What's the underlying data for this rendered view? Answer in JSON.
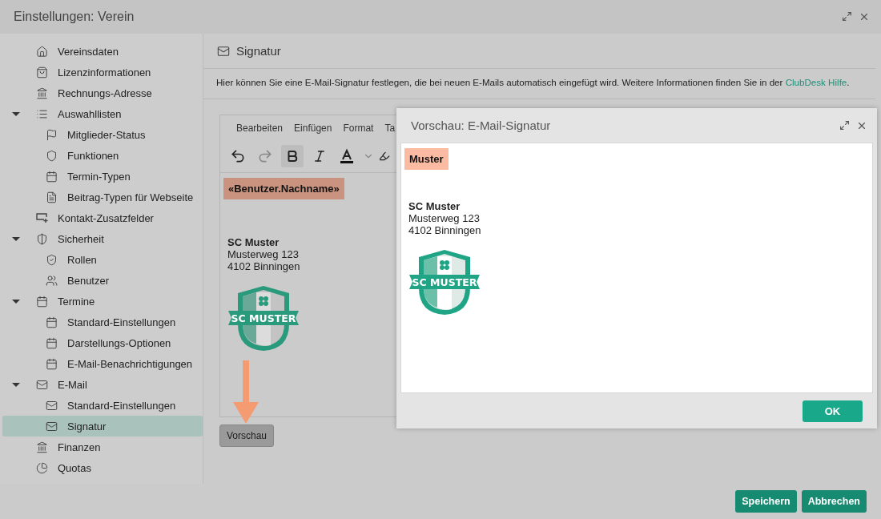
{
  "window": {
    "title": "Einstellungen: Verein"
  },
  "sidebar": {
    "items": [
      {
        "label": "Vereinsdaten",
        "selected": false
      },
      {
        "label": "Lizenzinformationen",
        "selected": false
      },
      {
        "label": "Rechnungs-Adresse",
        "selected": false
      },
      {
        "label": "Auswahllisten",
        "selected": false,
        "expanded": true,
        "children": [
          {
            "label": "Mitglieder-Status",
            "selected": false
          },
          {
            "label": "Funktionen",
            "selected": false
          },
          {
            "label": "Termin-Typen",
            "selected": false
          },
          {
            "label": "Beitrag-Typen für Webseite",
            "selected": false
          }
        ]
      },
      {
        "label": "Kontakt-Zusatzfelder",
        "selected": false
      },
      {
        "label": "Sicherheit",
        "selected": false,
        "expanded": true,
        "children": [
          {
            "label": "Rollen",
            "selected": false
          },
          {
            "label": "Benutzer",
            "selected": false
          }
        ]
      },
      {
        "label": "Termine",
        "selected": false,
        "expanded": true,
        "children": [
          {
            "label": "Standard-Einstellungen",
            "selected": false
          },
          {
            "label": "Darstellungs-Optionen",
            "selected": false
          },
          {
            "label": "E-Mail-Benachrichtigungen",
            "selected": false
          }
        ]
      },
      {
        "label": "E-Mail",
        "selected": false,
        "expanded": true,
        "children": [
          {
            "label": "Standard-Einstellungen",
            "selected": false
          },
          {
            "label": "Signatur",
            "selected": true
          }
        ]
      },
      {
        "label": "Finanzen",
        "selected": false
      },
      {
        "label": "Quotas",
        "selected": false
      }
    ]
  },
  "panel": {
    "title": "Signatur",
    "description": "Hier können Sie eine E-Mail-Signatur festlegen, die bei neuen E-Mails automatisch eingefügt wird. Weitere Informationen finden Sie in der ",
    "link": "ClubDesk Hilfe",
    "description_end": ".",
    "editor": {
      "menu": [
        "Bearbeiten",
        "Einfügen",
        "Format",
        "Ta"
      ],
      "bold_active": true,
      "field": "«Benutzer.Nachname»",
      "name": "SC Muster",
      "street": "Musterweg 123",
      "city": "4102 Binningen",
      "logo_text": "SC MUSTER"
    },
    "preview_button": "Vorschau"
  },
  "footer": {
    "buttons": [
      "Speichern",
      "Abbrechen"
    ]
  },
  "dialog": {
    "title": "Vorschau: E-Mail-Signatur",
    "field": "Muster",
    "name": "SC Muster",
    "street": "Musterweg 123",
    "city": "4102 Binningen",
    "logo_text": "SC MUSTER",
    "ok_button": "OK"
  }
}
